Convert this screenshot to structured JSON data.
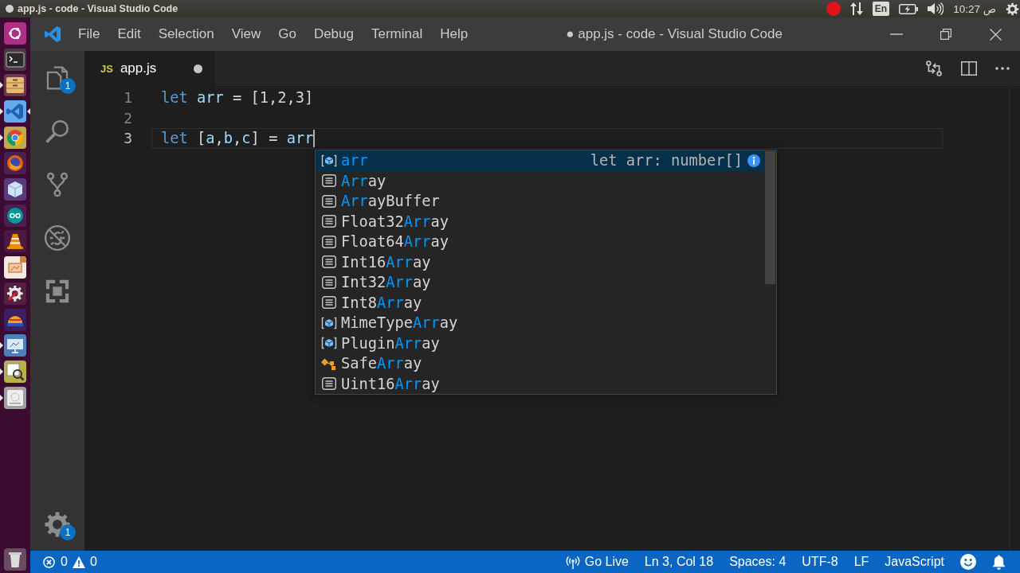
{
  "top_panel": {
    "title": "app.js - code - Visual Studio Code",
    "indicators": [
      {
        "kind": "record"
      },
      {
        "kind": "network"
      },
      {
        "kind": "keyboard",
        "label": "En"
      },
      {
        "kind": "battery"
      },
      {
        "kind": "volume"
      },
      {
        "kind": "clock",
        "label": "ص 10:27"
      },
      {
        "kind": "power"
      }
    ]
  },
  "launcher": {
    "apps": [
      {
        "kind": "dash",
        "running": false,
        "focused": false
      },
      {
        "kind": "terminal",
        "running": false,
        "focused": false
      },
      {
        "kind": "files",
        "running": true,
        "focused": false
      },
      {
        "kind": "code-editor",
        "running": true,
        "focused": true
      },
      {
        "kind": "browser",
        "running": true,
        "focused": false
      },
      {
        "kind": "globe",
        "running": false,
        "focused": false
      },
      {
        "kind": "cube",
        "running": false,
        "focused": false
      },
      {
        "kind": "infinity",
        "running": false,
        "focused": false
      },
      {
        "kind": "media-player",
        "running": false,
        "focused": false
      },
      {
        "kind": "presentation",
        "running": false,
        "focused": false
      },
      {
        "kind": "tools",
        "running": false,
        "focused": false
      },
      {
        "kind": "dome",
        "running": false,
        "focused": false
      },
      {
        "kind": "monitor",
        "running": true,
        "focused": false
      },
      {
        "kind": "image-viewer",
        "running": true,
        "focused": false
      },
      {
        "kind": "drive",
        "running": true,
        "focused": false
      }
    ],
    "trash": {
      "kind": "trash",
      "running": false,
      "focused": false
    }
  },
  "menu_bar": {
    "items": [
      "File",
      "Edit",
      "Selection",
      "View",
      "Go",
      "Debug",
      "Terminal",
      "Help"
    ],
    "title": "● app.js - code - Visual Studio Code"
  },
  "window_controls": [
    {
      "kind": "minimize"
    },
    {
      "kind": "restore"
    },
    {
      "kind": "close"
    }
  ],
  "activity_bar": {
    "items": [
      {
        "kind": "explorer",
        "badge": "1",
        "selected": false
      },
      {
        "kind": "search",
        "selected": false
      },
      {
        "kind": "source-control",
        "selected": false
      },
      {
        "kind": "debug",
        "selected": false
      },
      {
        "kind": "extensions",
        "selected": false
      }
    ],
    "manage": {
      "kind": "settings",
      "badge": "1"
    }
  },
  "tabs": [
    {
      "file_type": "JS",
      "label": "app.js",
      "dirty": true,
      "selected": true
    }
  ],
  "editor_actions": [
    {
      "kind": "compare"
    },
    {
      "kind": "split"
    },
    {
      "kind": "more"
    }
  ],
  "editor": {
    "lines": [
      {
        "number": "1",
        "current": false,
        "tokens": [
          {
            "kind": "keyword",
            "text": "let "
          },
          {
            "kind": "variable",
            "text": "arr"
          },
          {
            "kind": "operator",
            "text": " = "
          },
          {
            "kind": "literal",
            "text": "[1,2,3]"
          }
        ]
      },
      {
        "number": "2",
        "current": false
      },
      {
        "number": "3",
        "current": true,
        "tokens": [
          {
            "kind": "keyword",
            "text": "let "
          },
          {
            "kind": "punctuation",
            "text": "["
          },
          {
            "kind": "variable",
            "text": "a"
          },
          {
            "kind": "punctuation",
            "text": ","
          },
          {
            "kind": "variable",
            "text": "b"
          },
          {
            "kind": "punctuation",
            "text": ","
          },
          {
            "kind": "variable",
            "text": "c"
          },
          {
            "kind": "punctuation",
            "text": "]"
          },
          {
            "kind": "operator",
            "text": " = "
          },
          {
            "kind": "variable",
            "text": "arr"
          }
        ]
      }
    ]
  },
  "suggestions": [
    {
      "kind": "variable",
      "match": "arr",
      "detail": "let arr: number[]",
      "selected": true
    },
    {
      "kind": "module",
      "match": "Arr",
      "suffix": "ay",
      "selected": false
    },
    {
      "kind": "module",
      "match": "Arr",
      "suffix": "ayBuffer",
      "selected": false
    },
    {
      "kind": "module",
      "prefix": "Float32",
      "match": "Arr",
      "suffix": "ay",
      "selected": false
    },
    {
      "kind": "module",
      "prefix": "Float64",
      "match": "Arr",
      "suffix": "ay",
      "selected": false
    },
    {
      "kind": "module",
      "prefix": "Int16",
      "match": "Arr",
      "suffix": "ay",
      "selected": false
    },
    {
      "kind": "module",
      "prefix": "Int32",
      "match": "Arr",
      "suffix": "ay",
      "selected": false
    },
    {
      "kind": "module",
      "prefix": "Int8",
      "match": "Arr",
      "suffix": "ay",
      "selected": false
    },
    {
      "kind": "variable",
      "prefix": "MimeType",
      "match": "Arr",
      "suffix": "ay",
      "selected": false
    },
    {
      "kind": "variable",
      "prefix": "Plugin",
      "match": "Arr",
      "suffix": "ay",
      "selected": false
    },
    {
      "kind": "class",
      "prefix": "Safe",
      "match": "Arr",
      "suffix": "ay",
      "selected": false
    },
    {
      "kind": "module",
      "prefix": "Uint16",
      "match": "Arr",
      "suffix": "ay",
      "selected": false
    }
  ],
  "status_bar": {
    "left": [
      {
        "kind": "errors",
        "label": "0"
      },
      {
        "kind": "warnings",
        "label": "0"
      }
    ],
    "right": [
      {
        "kind": "live",
        "label": "Go Live"
      },
      {
        "kind": "text",
        "label": "Ln 3, Col 18"
      },
      {
        "kind": "text",
        "label": "Spaces: 4"
      },
      {
        "kind": "text",
        "label": "UTF-8"
      },
      {
        "kind": "text",
        "label": "LF"
      },
      {
        "kind": "text",
        "label": "JavaScript"
      },
      {
        "kind": "feedback"
      },
      {
        "kind": "notifications"
      }
    ]
  }
}
